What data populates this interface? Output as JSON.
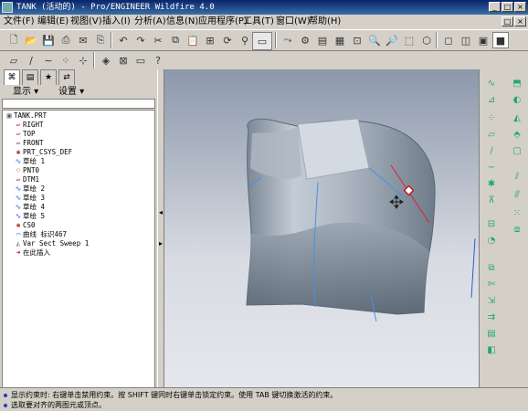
{
  "window": {
    "title": "TANK (活动的) - Pro/ENGINEER Wildfire 4.0"
  },
  "menubar": [
    {
      "label": "文件(F)"
    },
    {
      "label": "编辑(E)"
    },
    {
      "label": "视图(V)"
    },
    {
      "label": "插入(I)"
    },
    {
      "label": "分析(A)"
    },
    {
      "label": "信息(N)"
    },
    {
      "label": "应用程序(P)"
    },
    {
      "label": "工具(T)"
    },
    {
      "label": "窗口(W)"
    },
    {
      "label": "帮助(H)"
    }
  ],
  "tree_header": {
    "show_label": "显示",
    "settings_label": "设置"
  },
  "model_tree": {
    "items": [
      {
        "icon": "part-icon",
        "label": "TANK.PRT"
      },
      {
        "icon": "datum-plane-icon",
        "label": "RIGHT"
      },
      {
        "icon": "datum-plane-icon",
        "label": "TOP"
      },
      {
        "icon": "datum-plane-icon",
        "label": "FRONT"
      },
      {
        "icon": "csys-icon",
        "label": "PRT_CSYS_DEF"
      },
      {
        "icon": "sketch-icon",
        "label": "草绘 1"
      },
      {
        "icon": "datum-point-icon",
        "label": "PNT0"
      },
      {
        "icon": "datum-plane-icon",
        "label": "DTM1"
      },
      {
        "icon": "sketch-icon",
        "label": "草绘 2"
      },
      {
        "icon": "sketch-icon",
        "label": "草绘 3"
      },
      {
        "icon": "sketch-icon",
        "label": "草绘 4"
      },
      {
        "icon": "sketch-icon",
        "label": "草绘 5"
      },
      {
        "icon": "csys-icon",
        "label": "CS0"
      },
      {
        "icon": "curve-icon",
        "label": "曲线 标识467"
      },
      {
        "icon": "sweep-icon",
        "label": "Var Sect Sweep 1"
      },
      {
        "icon": "insert-here-icon",
        "label": "在此插入"
      }
    ]
  },
  "status": {
    "messages": [
      "显示约束时: 右键单击禁用约束。按 SHIFT 键同时右键单击锁定约束。使用 TAB 键切换激活的约束。",
      "选取要对齐的两图元或顶点。"
    ]
  },
  "colors": {
    "title_bar": "#0a246a",
    "viewport_top": "#8c98ab",
    "viewport_bottom": "#e5e7ec",
    "model": "#9aa6b4",
    "edge": "#4a90d9"
  }
}
